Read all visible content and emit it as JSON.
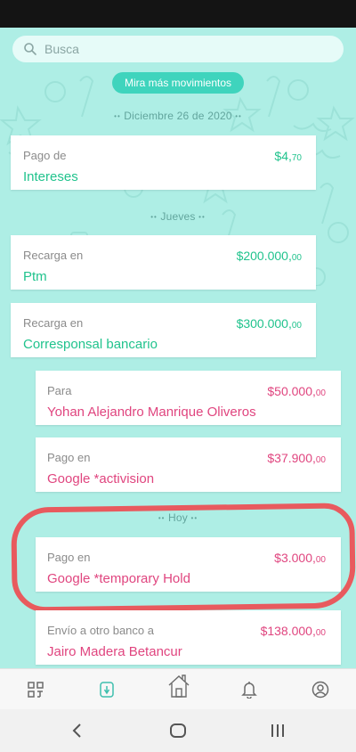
{
  "search": {
    "placeholder": "Busca"
  },
  "more_button": "Mira más movimientos",
  "dates": {
    "first": "Diciembre 26 de 2020",
    "second": "Jueves",
    "third": "Hoy"
  },
  "transactions": [
    {
      "label": "Pago de",
      "amount_main": "$4,",
      "amount_cents": "70",
      "name": "Intereses",
      "direction": "in"
    },
    {
      "label": "Recarga en",
      "amount_main": "$200.000,",
      "amount_cents": "00",
      "name": "Ptm",
      "direction": "in"
    },
    {
      "label": "Recarga en",
      "amount_main": "$300.000,",
      "amount_cents": "00",
      "name": "Corresponsal bancario",
      "direction": "in"
    },
    {
      "label": "Para",
      "amount_main": "$50.000,",
      "amount_cents": "00",
      "name": "Yohan Alejandro Manrique Oliveros",
      "direction": "out"
    },
    {
      "label": "Pago en",
      "amount_main": "$37.900,",
      "amount_cents": "00",
      "name": "Google *activision",
      "direction": "out"
    },
    {
      "label": "Pago en",
      "amount_main": "$3.000,",
      "amount_cents": "00",
      "name": "Google *temporary Hold",
      "direction": "out"
    },
    {
      "label": "Envío a otro banco a",
      "amount_main": "$138.000,",
      "amount_cents": "00",
      "name": "Jairo Madera Betancur",
      "direction": "out"
    }
  ],
  "nav": {
    "items": [
      "apps-icon",
      "wallet-icon",
      "home-icon",
      "bell-icon",
      "profile-icon"
    ],
    "active": "wallet-icon"
  },
  "colors": {
    "background": "#aeeee5",
    "accent": "#3fd4bd",
    "income": "#21c38d",
    "expense": "#e0457f",
    "highlight": "#e85a5e"
  }
}
